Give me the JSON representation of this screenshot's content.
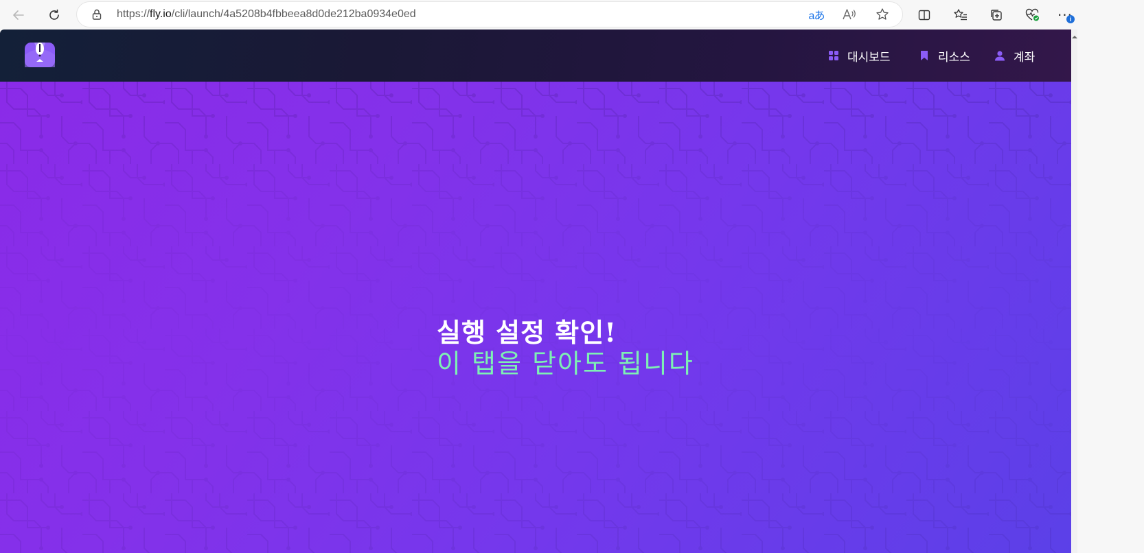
{
  "browser": {
    "url_prefix": "https://",
    "url_host": "fly.io",
    "url_path": "/cli/launch/4a5208b4fbbeea8d0de212ba0934e0ed",
    "translate_glyph": "aあ",
    "read_aloud_glyph": "Aᴬ",
    "more_glyph": "···",
    "info_badge": "i",
    "icons": {
      "back": "back-arrow-icon",
      "refresh": "refresh-icon",
      "lock": "lock-icon",
      "translate": "translate-icon",
      "read_aloud": "read-aloud-icon",
      "favorite": "star-icon",
      "split_screen": "split-screen-icon",
      "favorites": "favorites-list-icon",
      "collections": "collections-icon",
      "browser_essentials": "heart-pulse-icon",
      "more": "more-icon"
    }
  },
  "site": {
    "nav": [
      {
        "label": "대시보드",
        "icon": "dashboard-grid-icon"
      },
      {
        "label": "리소스",
        "icon": "bookmark-icon"
      },
      {
        "label": "계좌",
        "icon": "user-icon"
      }
    ],
    "accent_color": "#8b5cf6"
  },
  "hero": {
    "title": "실행 설정 확인!",
    "subtitle": "이 탭을 닫아도 됩니다",
    "title_color": "#ffffff",
    "subtitle_color": "#7ef0b4",
    "gradient_start": "#8a2be8",
    "gradient_end": "#5b40e8"
  }
}
